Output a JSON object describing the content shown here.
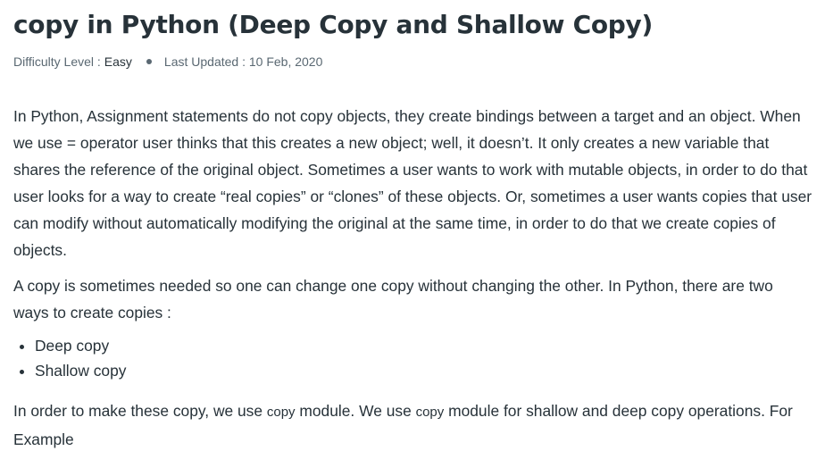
{
  "article": {
    "title": "copy in Python (Deep Copy and Shallow Copy)",
    "meta": {
      "difficulty_label": "Difficulty Level :",
      "difficulty_value": "Easy",
      "updated": "Last Updated : 10 Feb, 2020"
    },
    "paragraphs": [
      "In Python, Assignment statements do not copy objects, they create bindings between a target and an object. When we use = operator user thinks that this creates a new object; well, it doesn’t. It only creates a new variable that shares the reference of the original object. Sometimes a user wants to work with mutable objects, in order to do that user looks for a way to create “real copies” or “clones” of these objects. Or, sometimes a user wants copies that user can modify without automatically modifying the original at the same time, in order to do that we create copies of objects.",
      "A copy is sometimes needed so one can change one copy without changing the other. In Python, there are two ways to create copies :"
    ],
    "copy_types": [
      "Deep copy",
      "Shallow copy"
    ],
    "closing": {
      "part1": "In order to make these copy, we use ",
      "code1": "copy",
      "part2": " module. We use ",
      "code2": "copy",
      "part3": " module for shallow and deep copy operations. For Example"
    }
  }
}
